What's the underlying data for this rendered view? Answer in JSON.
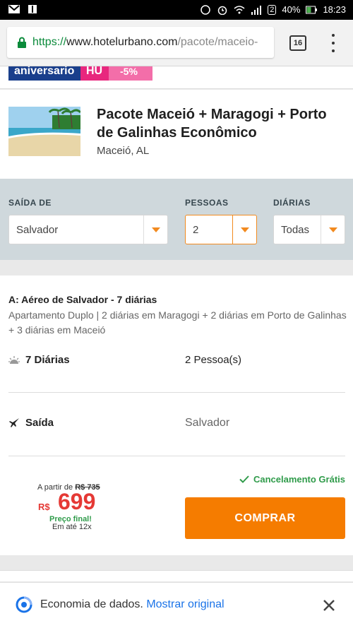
{
  "status_bar": {
    "battery": "40%",
    "time": "18:23",
    "sim_badge": "2"
  },
  "browser": {
    "url_scheme": "https://",
    "url_host": "www.hotelurbano.com",
    "url_path": "/pacote/maceio-",
    "tab_count": "16"
  },
  "banner": {
    "text_a": "aniversario",
    "text_b": "HU",
    "text_c": "-5%"
  },
  "product": {
    "title": "Pacote Maceió + Maragogi + Porto de Galinhas Econômico",
    "location": "Maceió, AL"
  },
  "filters": {
    "origin": {
      "label": "SAÍDA DE",
      "value": "Salvador"
    },
    "people": {
      "label": "PESSOAS",
      "value": "2"
    },
    "nights": {
      "label": "DIÁRIAS",
      "value": "Todas"
    }
  },
  "package": {
    "title": "A: Aéreo de Salvador - 7 diárias",
    "description": "Apartamento Duplo | 2 diárias em Maragogi + 2 diárias em Porto de Galinhas + 3 diárias em Maceió",
    "nights": "7 Diárias",
    "people": "2 Pessoa(s)",
    "departure_label": "Saída",
    "departure_value": "Salvador"
  },
  "pricing": {
    "cancel_text": "Cancelamento Grátis",
    "from_label": "A partir de",
    "old_price": "R$ 735",
    "currency": "R$",
    "price": "699",
    "final_label": "Preço final!",
    "installments": "Em até 12x",
    "buy_label": "COMPRAR"
  },
  "data_saver": {
    "text": "Economia de dados.",
    "link": "Mostrar original"
  },
  "colors": {
    "accent": "#f57c00",
    "price": "#e53935",
    "success": "#2f9b4a",
    "filter_bg": "#cfd8dc"
  }
}
